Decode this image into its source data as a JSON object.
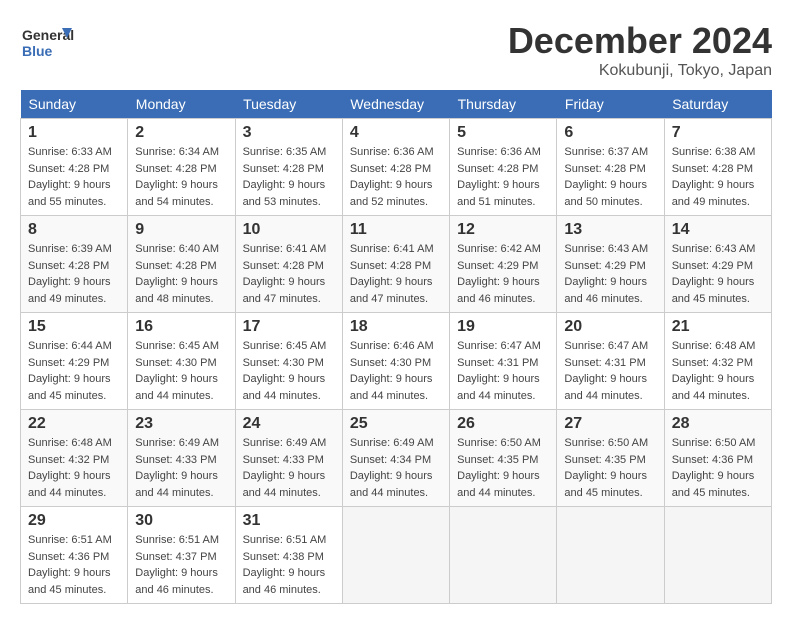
{
  "header": {
    "logo_text_general": "General",
    "logo_text_blue": "Blue",
    "month": "December 2024",
    "location": "Kokubunji, Tokyo, Japan"
  },
  "days_of_week": [
    "Sunday",
    "Monday",
    "Tuesday",
    "Wednesday",
    "Thursday",
    "Friday",
    "Saturday"
  ],
  "weeks": [
    [
      {
        "day": "1",
        "sunrise": "6:33 AM",
        "sunset": "4:28 PM",
        "daylight": "9 hours and 55 minutes."
      },
      {
        "day": "2",
        "sunrise": "6:34 AM",
        "sunset": "4:28 PM",
        "daylight": "9 hours and 54 minutes."
      },
      {
        "day": "3",
        "sunrise": "6:35 AM",
        "sunset": "4:28 PM",
        "daylight": "9 hours and 53 minutes."
      },
      {
        "day": "4",
        "sunrise": "6:36 AM",
        "sunset": "4:28 PM",
        "daylight": "9 hours and 52 minutes."
      },
      {
        "day": "5",
        "sunrise": "6:36 AM",
        "sunset": "4:28 PM",
        "daylight": "9 hours and 51 minutes."
      },
      {
        "day": "6",
        "sunrise": "6:37 AM",
        "sunset": "4:28 PM",
        "daylight": "9 hours and 50 minutes."
      },
      {
        "day": "7",
        "sunrise": "6:38 AM",
        "sunset": "4:28 PM",
        "daylight": "9 hours and 49 minutes."
      }
    ],
    [
      {
        "day": "8",
        "sunrise": "6:39 AM",
        "sunset": "4:28 PM",
        "daylight": "9 hours and 49 minutes."
      },
      {
        "day": "9",
        "sunrise": "6:40 AM",
        "sunset": "4:28 PM",
        "daylight": "9 hours and 48 minutes."
      },
      {
        "day": "10",
        "sunrise": "6:41 AM",
        "sunset": "4:28 PM",
        "daylight": "9 hours and 47 minutes."
      },
      {
        "day": "11",
        "sunrise": "6:41 AM",
        "sunset": "4:28 PM",
        "daylight": "9 hours and 47 minutes."
      },
      {
        "day": "12",
        "sunrise": "6:42 AM",
        "sunset": "4:29 PM",
        "daylight": "9 hours and 46 minutes."
      },
      {
        "day": "13",
        "sunrise": "6:43 AM",
        "sunset": "4:29 PM",
        "daylight": "9 hours and 46 minutes."
      },
      {
        "day": "14",
        "sunrise": "6:43 AM",
        "sunset": "4:29 PM",
        "daylight": "9 hours and 45 minutes."
      }
    ],
    [
      {
        "day": "15",
        "sunrise": "6:44 AM",
        "sunset": "4:29 PM",
        "daylight": "9 hours and 45 minutes."
      },
      {
        "day": "16",
        "sunrise": "6:45 AM",
        "sunset": "4:30 PM",
        "daylight": "9 hours and 44 minutes."
      },
      {
        "day": "17",
        "sunrise": "6:45 AM",
        "sunset": "4:30 PM",
        "daylight": "9 hours and 44 minutes."
      },
      {
        "day": "18",
        "sunrise": "6:46 AM",
        "sunset": "4:30 PM",
        "daylight": "9 hours and 44 minutes."
      },
      {
        "day": "19",
        "sunrise": "6:47 AM",
        "sunset": "4:31 PM",
        "daylight": "9 hours and 44 minutes."
      },
      {
        "day": "20",
        "sunrise": "6:47 AM",
        "sunset": "4:31 PM",
        "daylight": "9 hours and 44 minutes."
      },
      {
        "day": "21",
        "sunrise": "6:48 AM",
        "sunset": "4:32 PM",
        "daylight": "9 hours and 44 minutes."
      }
    ],
    [
      {
        "day": "22",
        "sunrise": "6:48 AM",
        "sunset": "4:32 PM",
        "daylight": "9 hours and 44 minutes."
      },
      {
        "day": "23",
        "sunrise": "6:49 AM",
        "sunset": "4:33 PM",
        "daylight": "9 hours and 44 minutes."
      },
      {
        "day": "24",
        "sunrise": "6:49 AM",
        "sunset": "4:33 PM",
        "daylight": "9 hours and 44 minutes."
      },
      {
        "day": "25",
        "sunrise": "6:49 AM",
        "sunset": "4:34 PM",
        "daylight": "9 hours and 44 minutes."
      },
      {
        "day": "26",
        "sunrise": "6:50 AM",
        "sunset": "4:35 PM",
        "daylight": "9 hours and 44 minutes."
      },
      {
        "day": "27",
        "sunrise": "6:50 AM",
        "sunset": "4:35 PM",
        "daylight": "9 hours and 45 minutes."
      },
      {
        "day": "28",
        "sunrise": "6:50 AM",
        "sunset": "4:36 PM",
        "daylight": "9 hours and 45 minutes."
      }
    ],
    [
      {
        "day": "29",
        "sunrise": "6:51 AM",
        "sunset": "4:36 PM",
        "daylight": "9 hours and 45 minutes."
      },
      {
        "day": "30",
        "sunrise": "6:51 AM",
        "sunset": "4:37 PM",
        "daylight": "9 hours and 46 minutes."
      },
      {
        "day": "31",
        "sunrise": "6:51 AM",
        "sunset": "4:38 PM",
        "daylight": "9 hours and 46 minutes."
      },
      null,
      null,
      null,
      null
    ]
  ]
}
